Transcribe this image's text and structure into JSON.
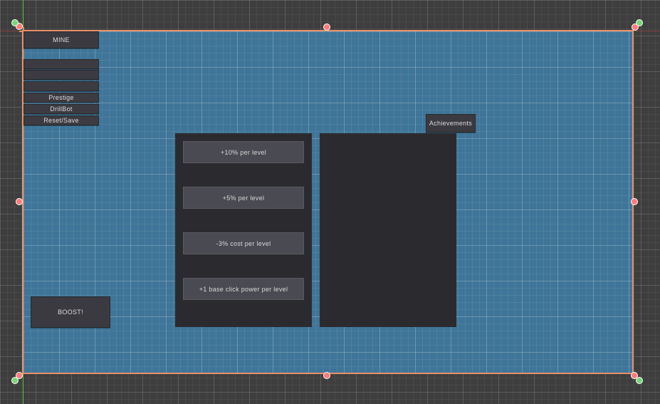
{
  "colors": {
    "editor_background": "#3e3e3e",
    "canvas_fill": "#3f7598",
    "canvas_border": "#e8916a",
    "button_fill": "#3a3a40",
    "panel_fill": "#2b2b2f",
    "upgrade_button_fill": "#4a4a52"
  },
  "sidebar": {
    "mine_label": "MINE",
    "items": [
      {
        "label": ""
      },
      {
        "label": ""
      },
      {
        "label": ""
      },
      {
        "label": "Prestige"
      },
      {
        "label": "DrillBot"
      },
      {
        "label": "Reset/Save"
      }
    ]
  },
  "achievements_label": "Achievements",
  "upgrades": [
    {
      "label": "+10% per level"
    },
    {
      "label": "+5% per level"
    },
    {
      "label": "-3% cost per level"
    },
    {
      "label": "+1 base click power per level"
    }
  ],
  "boost_label": "BOOST!"
}
